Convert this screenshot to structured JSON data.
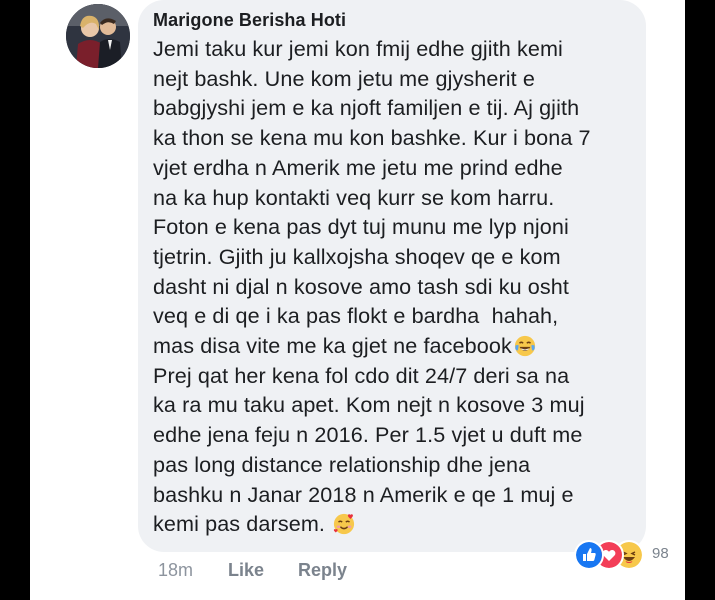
{
  "comment": {
    "author": "Marigone Berisha Hoti",
    "lines": [
      "Jemi taku kur jemi kon fmij edhe gjith kemi",
      "nejt bashk. Une kom jetu me gjysherit e",
      "babgjyshi jem e ka njoft familjen e tij. Aj gjith",
      "ka thon se kena mu kon bashke. Kur i bona 7",
      "vjet erdha n Amerik me jetu me prind edhe",
      "na ka hup kontakti veq kurr se kom harru.",
      "Foton e kena pas dyt tuj munu me lyp njoni",
      "tjetrin. Gjith ju kallxojsha shoqev qe e kom",
      "dasht ni djal n kosove amo tash sdi ku osht",
      "veq e di qe i ka pas flokt e bardha  hahah,",
      "mas disa vite me ka gjet ne facebook",
      "Prej qat her kena fol cdo dit 24/7 deri sa na",
      "ka ra mu taku apet. Kom nejt n kosove 3 muj",
      "edhe jena feju n 2016. Per 1.5 vjet u duft me",
      "pas long distance relationship dhe jena",
      "bashku n Janar 2018 n Amerik e qe 1 muj e",
      "kemi pas darsem."
    ],
    "timestamp": "18m",
    "like_label": "Like",
    "reply_label": "Reply",
    "reaction_count": "98",
    "reactions": [
      "like-icon",
      "love-icon",
      "haha-icon"
    ],
    "inline_emojis": [
      "laughing-tears-emoji",
      "smiling-hearts-emoji"
    ]
  },
  "colors": {
    "bubble": "#eff1f4",
    "text": "#1c1e21",
    "meta": "#8d949e",
    "like_blue": "#1877f2",
    "love_red": "#f33e58",
    "haha_yellow": "#f7c84b"
  }
}
